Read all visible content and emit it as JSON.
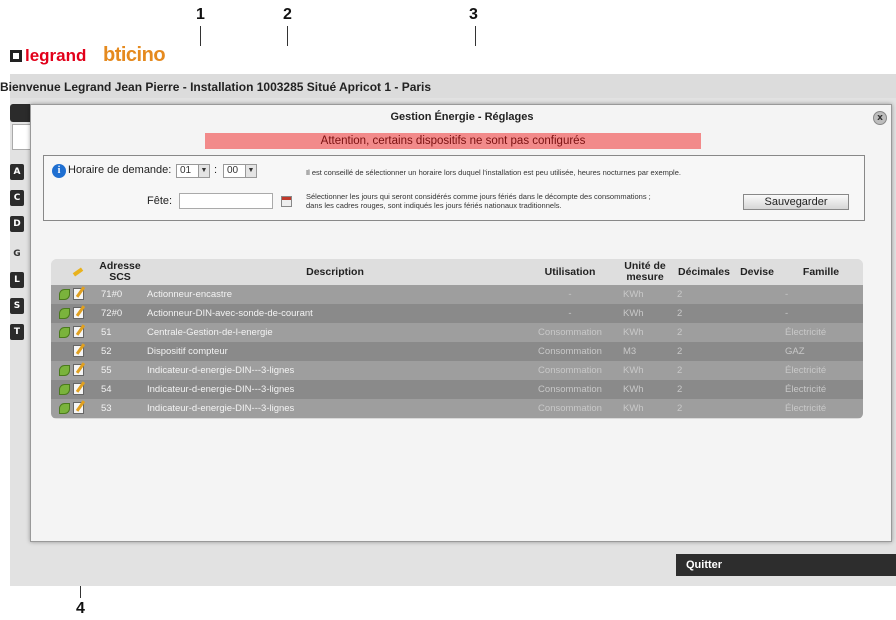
{
  "callouts": [
    "1",
    "2",
    "3",
    "4"
  ],
  "brand": {
    "legrand": "legrand",
    "btcino": "bticino"
  },
  "welcome": "Bienvenue Legrand Jean Pierre - Installation 1003285 Situé Apricot 1 - Paris",
  "side_buttons": [
    "A",
    "C",
    "D",
    "G",
    "L",
    "S",
    "T"
  ],
  "dialog": {
    "title": "Gestion Énergie - Réglages",
    "close_label": "x",
    "warning": "Attention, certains dispositifs ne sont pas configurés",
    "schedule_label": "Horaire de demande:",
    "hour_value": "01",
    "minute_value": "00",
    "time_separator": ":",
    "holiday_label": "Fête:",
    "holiday_value": "",
    "note_schedule": "Il est conseillé de sélectionner un horaire lors duquel l'installation est peu utilisée, heures nocturnes par exemple.",
    "note_holidays_1": "Sélectionner les jours qui seront considérés comme jours fériés dans le décompte des consommations ;",
    "note_holidays_2": "dans les cadres rouges, sont indiqués les jours fériés nationaux traditionnels.",
    "save_button": "Sauvegarder"
  },
  "table": {
    "columns": {
      "address": "Adresse SCS",
      "description": "Description",
      "usage": "Utilisation",
      "unit": "Unité de mesure",
      "decimals": "Décimales",
      "currency": "Devise",
      "family": "Famille"
    },
    "rows": [
      {
        "address": "71#0",
        "description": "Actionneur-encastre",
        "usage": "-",
        "unit": "KWh",
        "decimals": "2",
        "currency": "",
        "family": "-",
        "leaf": true
      },
      {
        "address": "72#0",
        "description": "Actionneur-DIN-avec-sonde-de-courant",
        "usage": "-",
        "unit": "KWh",
        "decimals": "2",
        "currency": "",
        "family": "-",
        "leaf": true
      },
      {
        "address": "51",
        "description": "Centrale-Gestion-de-l-energie",
        "usage": "Consommation",
        "unit": "KWh",
        "decimals": "2",
        "currency": "",
        "family": "Électricité",
        "leaf": true
      },
      {
        "address": "52",
        "description": "Dispositif compteur",
        "usage": "Consommation",
        "unit": "M3",
        "decimals": "2",
        "currency": "",
        "family": "GAZ",
        "leaf": false
      },
      {
        "address": "55",
        "description": "Indicateur-d-energie-DIN---3-lignes",
        "usage": "Consommation",
        "unit": "KWh",
        "decimals": "2",
        "currency": "",
        "family": "Électricité",
        "leaf": true
      },
      {
        "address": "54",
        "description": "Indicateur-d-energie-DIN---3-lignes",
        "usage": "Consommation",
        "unit": "KWh",
        "decimals": "2",
        "currency": "",
        "family": "Électricité",
        "leaf": true
      },
      {
        "address": "53",
        "description": "Indicateur-d-energie-DIN---3-lignes",
        "usage": "Consommation",
        "unit": "KWh",
        "decimals": "2",
        "currency": "",
        "family": "Électricité",
        "leaf": true
      }
    ]
  },
  "quit_label": "Quitter"
}
